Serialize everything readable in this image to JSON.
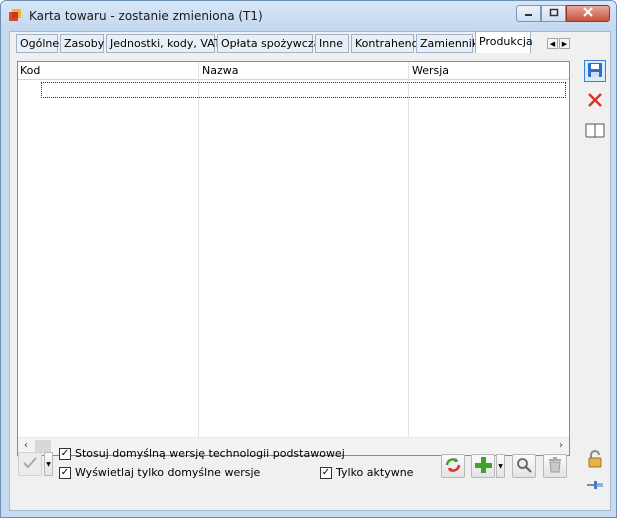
{
  "window": {
    "title": "Karta towaru - zostanie zmieniona (T1)"
  },
  "tabs": [
    {
      "label": "Ogólne"
    },
    {
      "label": "Zasoby"
    },
    {
      "label": "Jednostki, kody, VAT"
    },
    {
      "label": "Opłata spożywcza"
    },
    {
      "label": "Inne"
    },
    {
      "label": "Kontrahenci"
    },
    {
      "label": "Zamienniki"
    },
    {
      "label": "Produkcja",
      "active": true
    }
  ],
  "grid": {
    "columns": [
      "Kod",
      "Nazwa",
      "Wersja"
    ],
    "rows": []
  },
  "options": {
    "default_version": {
      "label": "Stosuj domyślną wersję technologii podstawowej",
      "checked": true
    },
    "show_default_only": {
      "label": "Wyświetlaj tylko domyślne wersje",
      "checked": true
    },
    "active_only": {
      "label": "Tylko aktywne",
      "checked": true
    }
  },
  "icons": {
    "save": "save-disk-icon",
    "cancel": "cancel-x-icon",
    "book": "book-icon",
    "lock": "lock-icon",
    "pin": "pin-icon",
    "confirm": "checkmark-icon",
    "refresh": "refresh-icon",
    "add": "plus-icon",
    "search": "magnifier-icon",
    "delete": "trash-icon"
  },
  "colors": {
    "accent": "#3b7fd1",
    "cancel": "#d9362b",
    "add": "#3fa22a"
  }
}
